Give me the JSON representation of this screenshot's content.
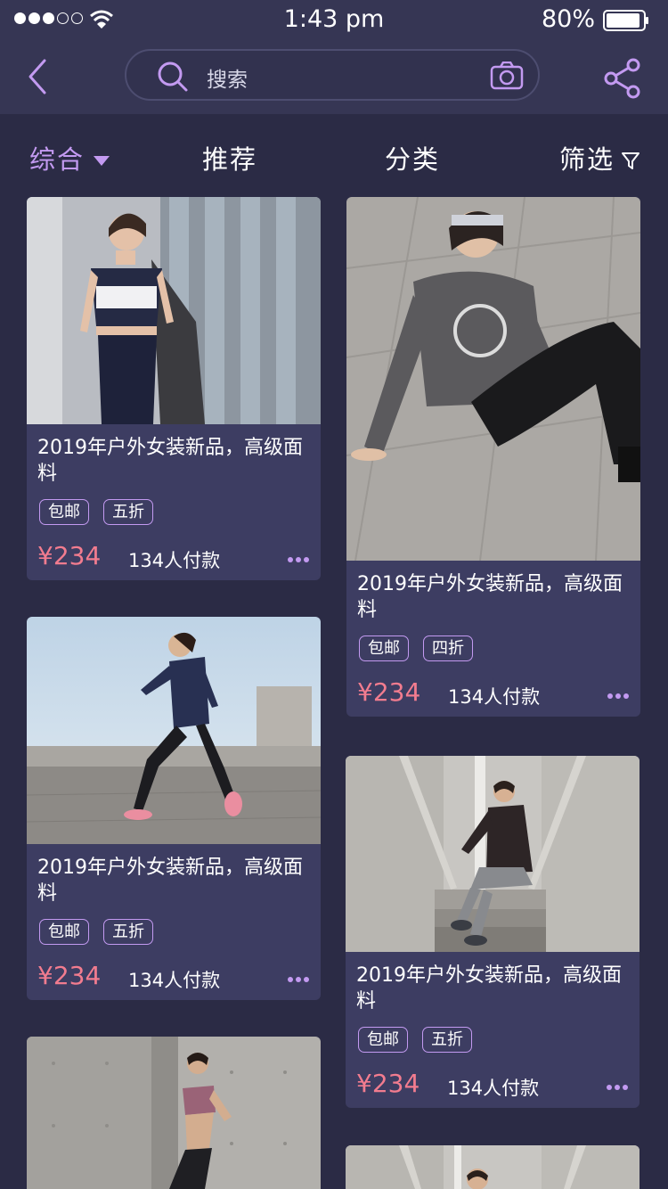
{
  "status_bar": {
    "time": "1:43 pm",
    "battery": "80%"
  },
  "header": {
    "search_placeholder": "搜索"
  },
  "tabs": [
    {
      "label": "综合",
      "active": true
    },
    {
      "label": "推荐"
    },
    {
      "label": "分类"
    },
    {
      "label": "筛选"
    }
  ],
  "products": [
    {
      "title": "2019年户外女装新品，高级面料",
      "tags": [
        "包邮",
        "五折"
      ],
      "price": "¥234",
      "paid": "134人付款",
      "photo": "woman-sports-bra-tote-bag"
    },
    {
      "title": "2019年户外女装新品，高级面料",
      "tags": [
        "包邮",
        "四折"
      ],
      "price": "¥234",
      "paid": "134人付款",
      "photo": "woman-grey-hoodie-sitting"
    },
    {
      "title": "2019年户外女装新品，高级面料",
      "tags": [
        "包邮",
        "五折"
      ],
      "price": "¥234",
      "paid": "134人付款",
      "photo": "woman-running-outdoor"
    },
    {
      "title": "2019年户外女装新品，高级面料",
      "tags": [
        "包邮",
        "五折"
      ],
      "price": "¥234",
      "paid": "134人付款",
      "photo": "woman-sitting-stairs"
    },
    {
      "photo": "woman-running-concrete"
    },
    {
      "photo": "woman-stairs-partial"
    }
  ],
  "colors": {
    "accent": "#c39af1",
    "price": "#f27c8f",
    "card": "#3d3d62",
    "background": "#2b2b45",
    "header": "#363654"
  }
}
